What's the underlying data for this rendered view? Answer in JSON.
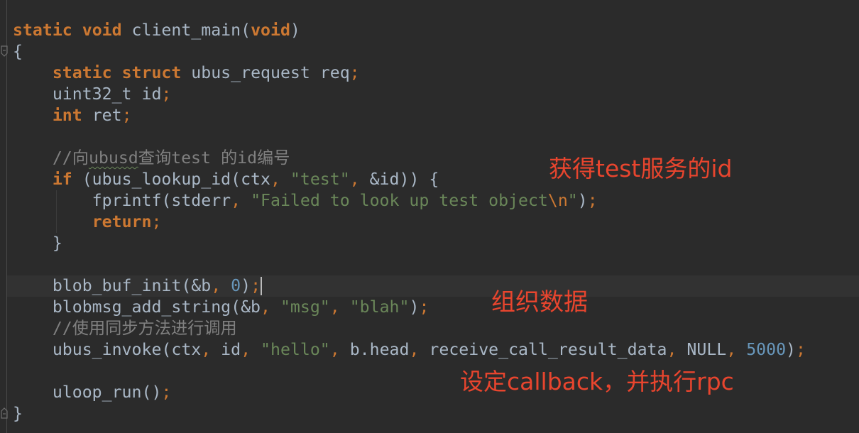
{
  "theme": {
    "background": "#2B2B2B",
    "text": "#A9B7C6",
    "keyword": "#CC7832",
    "string": "#6A8759",
    "number": "#6897BB",
    "comment": "#808080",
    "annotation": "#E8452E",
    "current_line": "#323232"
  },
  "icons": {
    "fold_open": "fold-open-icon",
    "fold_close": "fold-close-icon"
  },
  "editor": {
    "lines": [
      [
        [
          "kw",
          "static"
        ],
        [
          "txt",
          " "
        ],
        [
          "kw",
          "void"
        ],
        [
          "txt",
          " client_main("
        ],
        [
          "kw",
          "void"
        ],
        [
          "txt",
          ")"
        ]
      ],
      [
        [
          "txt",
          "{"
        ]
      ],
      [
        [
          "txt",
          "    "
        ],
        [
          "kw",
          "static"
        ],
        [
          "txt",
          " "
        ],
        [
          "kw",
          "struct"
        ],
        [
          "txt",
          " ubus_request req"
        ],
        [
          "punc",
          ";"
        ]
      ],
      [
        [
          "txt",
          "    uint32_t id"
        ],
        [
          "punc",
          ";"
        ]
      ],
      [
        [
          "txt",
          "    "
        ],
        [
          "kw",
          "int"
        ],
        [
          "txt",
          " ret"
        ],
        [
          "punc",
          ";"
        ]
      ],
      [],
      [
        [
          "txt",
          "    "
        ],
        [
          "cmt",
          "//向"
        ],
        [
          "typo",
          "ubusd"
        ],
        [
          "cmt",
          "查询test 的id编号"
        ]
      ],
      [
        [
          "txt",
          "    "
        ],
        [
          "kw",
          "if"
        ],
        [
          "txt",
          " (ubus_lookup_id(ctx"
        ],
        [
          "punc",
          ","
        ],
        [
          "txt",
          " "
        ],
        [
          "str",
          "\"test\""
        ],
        [
          "punc",
          ","
        ],
        [
          "txt",
          " &id)) {"
        ]
      ],
      [
        [
          "txt",
          "        fprintf(stderr"
        ],
        [
          "punc",
          ","
        ],
        [
          "txt",
          " "
        ],
        [
          "str",
          "\"Failed to look up test object"
        ],
        [
          "esc",
          "\\n"
        ],
        [
          "str",
          "\""
        ],
        [
          "txt",
          ")"
        ],
        [
          "punc",
          ";"
        ]
      ],
      [
        [
          "txt",
          "        "
        ],
        [
          "kw",
          "return"
        ],
        [
          "punc",
          ";"
        ]
      ],
      [
        [
          "txt",
          "    }"
        ]
      ],
      [],
      [
        [
          "txt",
          "    blob_buf_init(&b"
        ],
        [
          "punc",
          ","
        ],
        [
          "txt",
          " "
        ],
        [
          "num",
          "0"
        ],
        [
          "txt",
          ")"
        ],
        [
          "punc",
          ";"
        ]
      ],
      [
        [
          "txt",
          "    blobmsg_add_string(&b"
        ],
        [
          "punc",
          ","
        ],
        [
          "txt",
          " "
        ],
        [
          "str",
          "\"msg\""
        ],
        [
          "punc",
          ","
        ],
        [
          "txt",
          " "
        ],
        [
          "str",
          "\"blah\""
        ],
        [
          "txt",
          ")"
        ],
        [
          "punc",
          ";"
        ]
      ],
      [
        [
          "txt",
          "    "
        ],
        [
          "cmt",
          "//使用同步方法进行调用"
        ]
      ],
      [
        [
          "txt",
          "    ubus_invoke(ctx"
        ],
        [
          "punc",
          ","
        ],
        [
          "txt",
          " id"
        ],
        [
          "punc",
          ","
        ],
        [
          "txt",
          " "
        ],
        [
          "str",
          "\"hello\""
        ],
        [
          "punc",
          ","
        ],
        [
          "txt",
          " b.head"
        ],
        [
          "punc",
          ","
        ],
        [
          "txt",
          " receive_call_result_data"
        ],
        [
          "punc",
          ","
        ],
        [
          "txt",
          " NULL"
        ],
        [
          "punc",
          ","
        ],
        [
          "txt",
          " "
        ],
        [
          "num",
          "5000"
        ],
        [
          "txt",
          ")"
        ],
        [
          "punc",
          ";"
        ]
      ],
      [],
      [
        [
          "txt",
          "    uloop_run()"
        ],
        [
          "punc",
          ";"
        ]
      ],
      [
        [
          "txt",
          "}"
        ]
      ]
    ]
  },
  "annotations": {
    "lookup": "获得test服务的id",
    "build": "组织数据",
    "invoke": "设定callback，并执行rpc"
  }
}
